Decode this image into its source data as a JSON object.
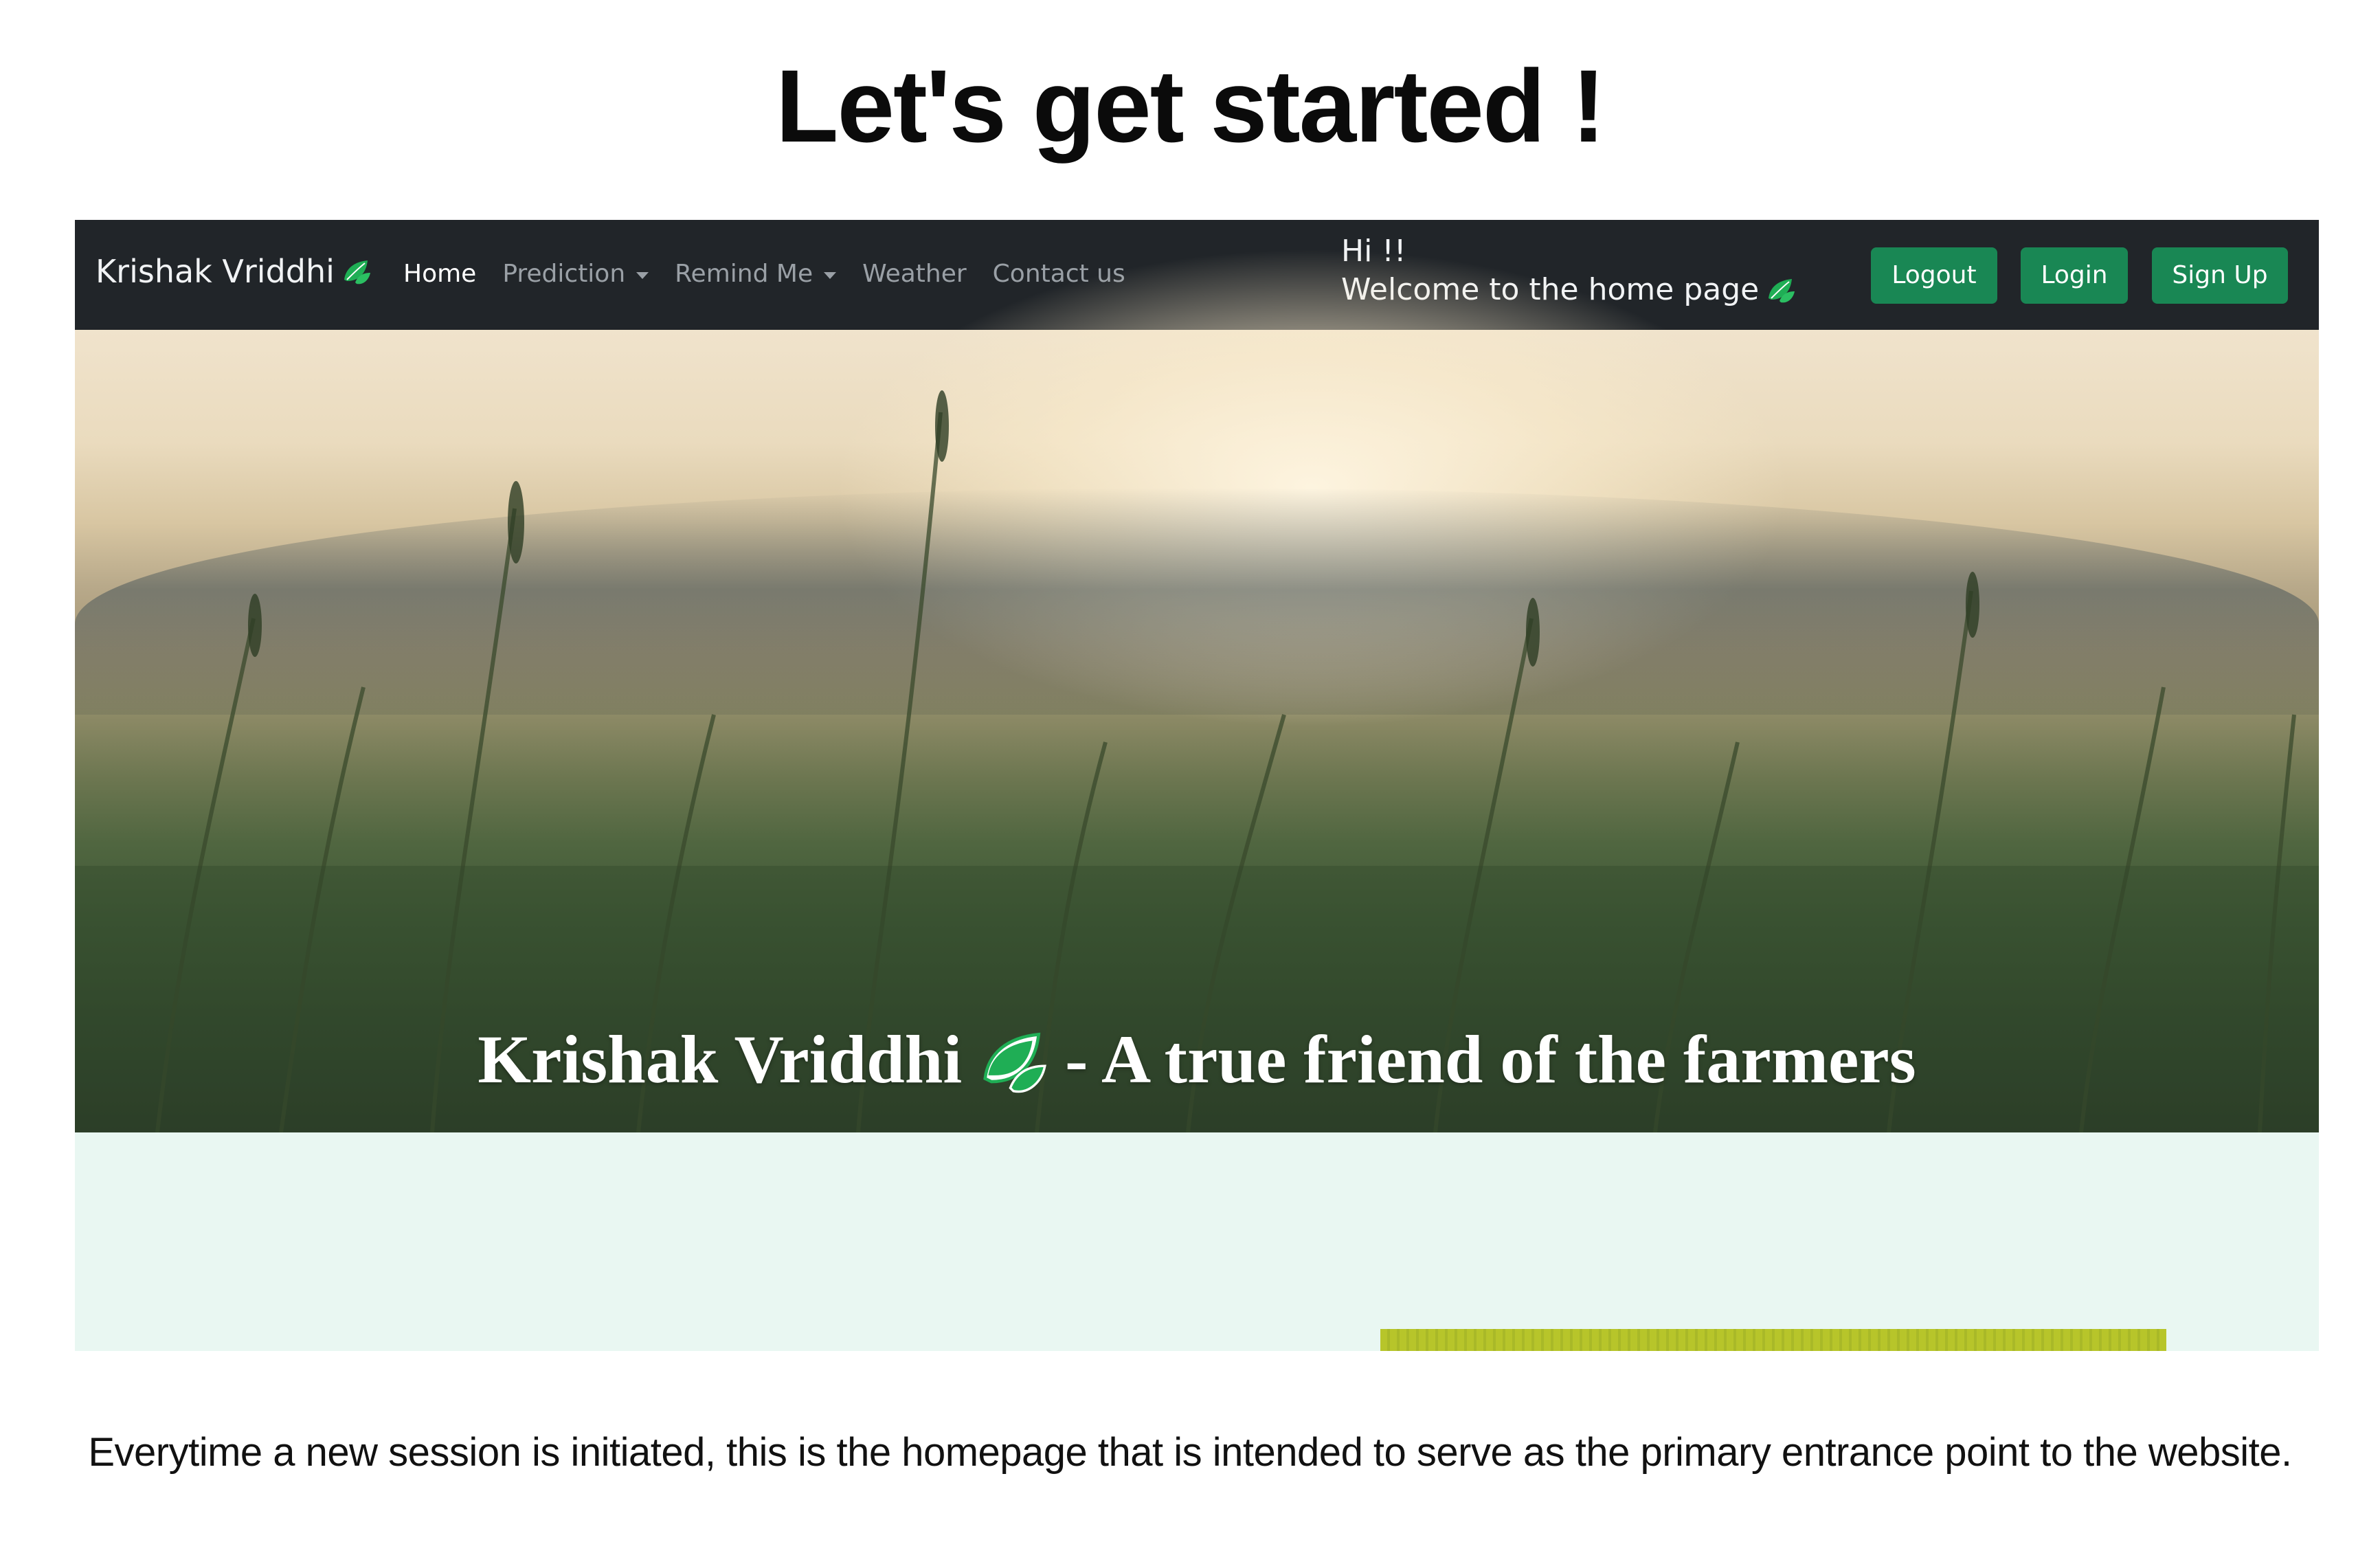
{
  "slide": {
    "title": "Let's get started !",
    "caption": "Everytime a new session is initiated, this is the homepage that is intended to serve as the primary entrance point to the website."
  },
  "navbar": {
    "brand": "Krishak Vriddhi",
    "brand_icon": "leaf-icon",
    "links": [
      {
        "label": "Home",
        "active": true,
        "dropdown": false
      },
      {
        "label": "Prediction",
        "active": false,
        "dropdown": true
      },
      {
        "label": "Remind Me",
        "active": false,
        "dropdown": true
      },
      {
        "label": "Weather",
        "active": false,
        "dropdown": false
      },
      {
        "label": "Contact us",
        "active": false,
        "dropdown": false
      }
    ],
    "greeting_line1": "Hi !!",
    "greeting_line2": "Welcome to the home page",
    "buttons": {
      "logout": "Logout",
      "login": "Login",
      "signup": "Sign Up"
    }
  },
  "hero": {
    "title_left": "Krishak Vriddhi",
    "title_right": "- A true friend of the farmers"
  },
  "colors": {
    "navbar_bg": "#212529",
    "button_green": "#198754",
    "lower_section_bg": "#e9f7f2",
    "leaf_green": "#1fae55"
  }
}
